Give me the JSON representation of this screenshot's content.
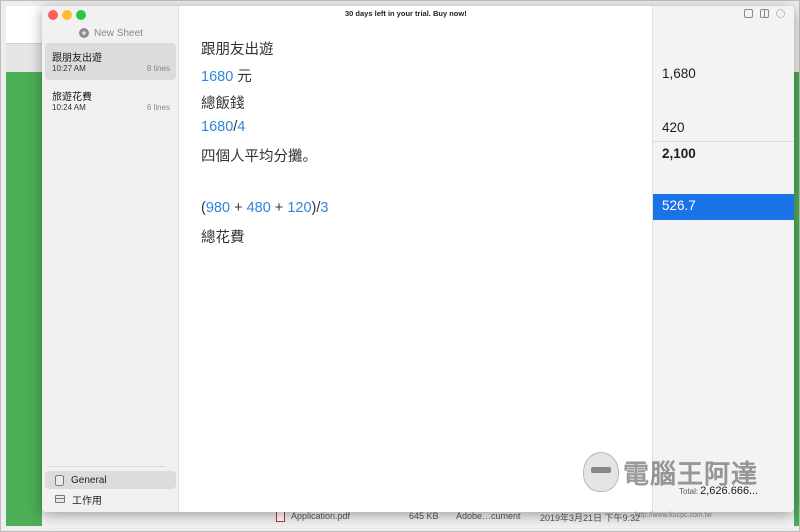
{
  "background": {
    "file_name": "Application.pdf",
    "file_size": "645 KB",
    "file_kind": "Adobe…cument",
    "file_date": "2019年3月21日 下午9:32"
  },
  "app": {
    "trial_banner": "30 days left in your trial. Buy now!",
    "sidebar": {
      "new_sheet_label": "New Sheet",
      "sheets": [
        {
          "title": "跟朋友出遊",
          "time": "10:27 AM",
          "lines": "8 lines",
          "selected": true
        },
        {
          "title": "旅遊花費",
          "time": "10:24 AM",
          "lines": "6 lines",
          "selected": false
        }
      ],
      "groups": [
        {
          "label": "General",
          "icon": "cylinder-icon",
          "selected": true
        },
        {
          "label": "工作用",
          "icon": "box-icon",
          "selected": false
        }
      ]
    },
    "editor": {
      "line1": "跟朋友出遊",
      "line2_num": "1680",
      "line2_unit": " 元",
      "line3": "總飯錢",
      "line4_a": "1680",
      "line4_op": "/",
      "line4_b": "4",
      "line5": "四個人平均分攤。",
      "line7_open": "(",
      "line7_a": "980",
      "line7_op1": " + ",
      "line7_b": "480",
      "line7_op2": " + ",
      "line7_c": "120",
      "line7_close": ")/",
      "line7_d": "3",
      "line8": "總花費"
    },
    "results": {
      "r2": "1,680",
      "r4": "420",
      "r5": "2,100",
      "r7": "526.7",
      "total_label": "Total:",
      "total_value": "2,626.666..."
    },
    "watermark": {
      "text": "電腦王阿達",
      "url": "http://www.kocpc.com.tw"
    },
    "colors": {
      "number": "#2e86de",
      "highlight": "#1a73e8"
    }
  }
}
